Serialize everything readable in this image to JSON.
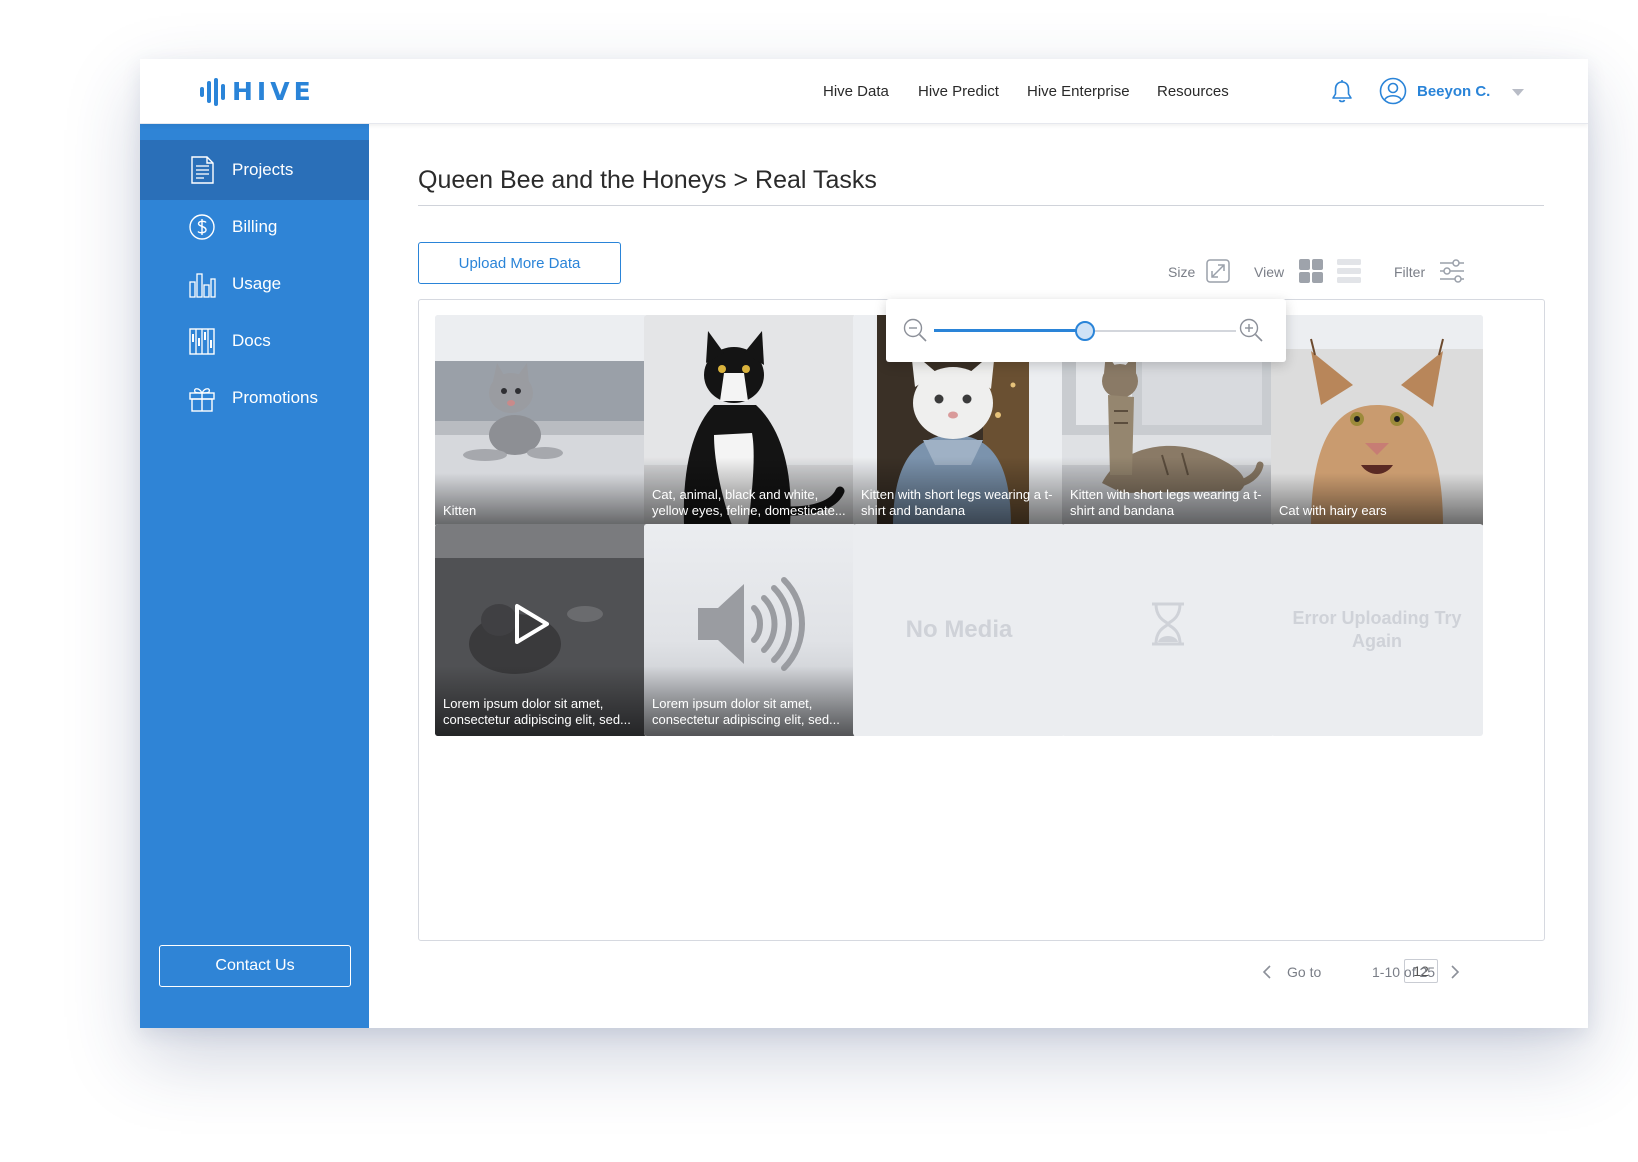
{
  "header": {
    "logo_text": "HIVE",
    "nav": [
      "Hive Data",
      "Hive Predict",
      "Hive Enterprise",
      "Resources"
    ],
    "user_name": "Beeyon C.",
    "brand_color": "#2a84d8"
  },
  "sidebar": {
    "items": [
      {
        "label": "Projects",
        "icon": "document-icon",
        "active": true
      },
      {
        "label": "Billing",
        "icon": "dollar-circle-icon"
      },
      {
        "label": "Usage",
        "icon": "bar-chart-icon"
      },
      {
        "label": "Docs",
        "icon": "docs-columns-icon"
      },
      {
        "label": "Promotions",
        "icon": "gift-icon"
      }
    ],
    "contact_label": "Contact Us",
    "color": "#2f84d6"
  },
  "main": {
    "breadcrumb": "Queen Bee and the Honeys > Real Tasks",
    "upload_label": "Upload More Data",
    "toolbar": {
      "size_label": "Size",
      "view_label": "View",
      "filter_label": "Filter"
    },
    "zoom_level": 0.5
  },
  "tiles": [
    {
      "caption": "Kitten",
      "kind": "image"
    },
    {
      "caption": "Cat, animal, black and white, yellow eyes, feline, domesticate...",
      "kind": "image"
    },
    {
      "caption": "Kitten with short legs wearing a t-shirt and bandana",
      "kind": "image"
    },
    {
      "caption": "Kitten with short legs wearing a t-shirt and bandana",
      "kind": "image"
    },
    {
      "caption": "Cat with hairy ears",
      "kind": "image"
    },
    {
      "caption": "Lorem ipsum dolor sit amet, consectetur adipiscing elit, sed...",
      "kind": "video"
    },
    {
      "caption": "Lorem ipsum dolor sit amet, consectetur adipiscing elit, sed...",
      "kind": "audio"
    },
    {
      "caption": "No Media",
      "kind": "empty"
    },
    {
      "caption": "",
      "kind": "loading"
    },
    {
      "caption": "Error Uploading Try Again",
      "kind": "error"
    }
  ],
  "pagination": {
    "goto_label": "Go to",
    "page": "12",
    "range": "1-10 of 25"
  }
}
